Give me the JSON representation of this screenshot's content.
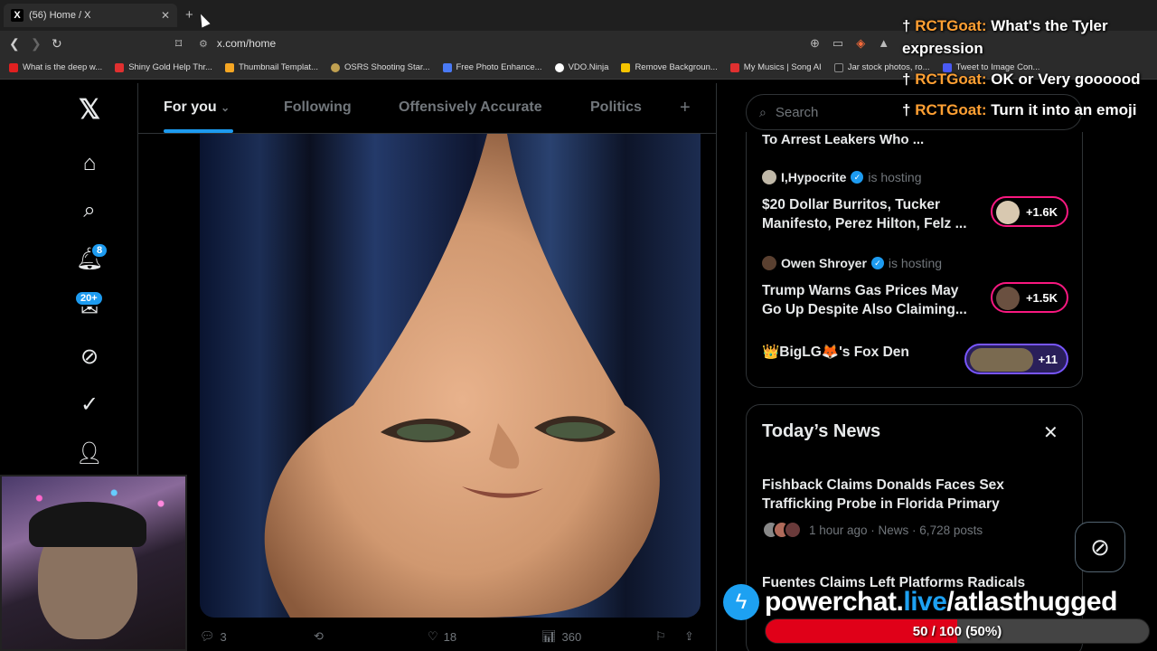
{
  "browser": {
    "tab_title": "(56) Home / X",
    "tab_favicon": "X",
    "url": "x.com/home",
    "bookmarks": [
      {
        "label": "What is the deep w...",
        "color": "#e02020"
      },
      {
        "label": "Shiny Gold Help Thr...",
        "color": "#e03030"
      },
      {
        "label": "Thumbnail Templat...",
        "color": "#f5a623"
      },
      {
        "label": "OSRS Shooting Star...",
        "color": "#c0a050"
      },
      {
        "label": "Free Photo Enhance...",
        "color": "#4a7af5"
      },
      {
        "label": "VDO.Ninja",
        "color": "#ffffff"
      },
      {
        "label": "Remove Backgroun...",
        "color": "#f5c400"
      },
      {
        "label": "My Musics | Song AI",
        "color": "#e03030"
      },
      {
        "label": "Jar stock photos, ro...",
        "color": "#222222"
      },
      {
        "label": "Tweet to Image Con...",
        "color": "#4a5af5"
      }
    ]
  },
  "nav": {
    "notifications_badge": "8",
    "messages_badge": "20+"
  },
  "feed_tabs": {
    "for_you": "For you",
    "following": "Following",
    "offensively": "Offensively Accurate",
    "politics": "Politics",
    "add": "+"
  },
  "post": {
    "replies": "3",
    "likes": "18",
    "views": "360"
  },
  "search": {
    "placeholder": "Search"
  },
  "spaces": {
    "cut_title": "To Arrest Leakers Who ...",
    "items": [
      {
        "host": "I,Hypocrite",
        "hosting": "is hosting",
        "title": "$20 Dollar Burritos, Tucker Manifesto, Perez Hilton, Felz ...",
        "count": "+1.6K"
      },
      {
        "host": "Owen Shroyer",
        "hosting": "is hosting",
        "title": "Trump Warns Gas Prices May Go Up Despite Also Claiming...",
        "count": "+1.5K"
      },
      {
        "title": "👑BigLG🦊's Fox Den",
        "count": "+11"
      }
    ]
  },
  "news": {
    "title": "Today’s News",
    "items": [
      {
        "headline": "Fishback Claims Donalds Faces Sex Trafficking Probe in Florida Primary",
        "meta": "1 hour ago · News · 6,728 posts"
      },
      {
        "headline": "Fuentes Claims Left Platforms Radicals"
      }
    ]
  },
  "chat": [
    {
      "user": "RCTGoat:",
      "text": "What's the Tyler expression"
    },
    {
      "user": "RCTGoat:",
      "text": "OK or Very goooood"
    },
    {
      "user": "RCTGoat:",
      "text": "Turn it into an emoji"
    }
  ],
  "overlay": {
    "brand_prefix": "powerchat.",
    "brand_mid": "live",
    "brand_suffix": "/atlasthugged",
    "goal_label": "50 / 100 (50%)",
    "goal_progress": 0.5
  }
}
